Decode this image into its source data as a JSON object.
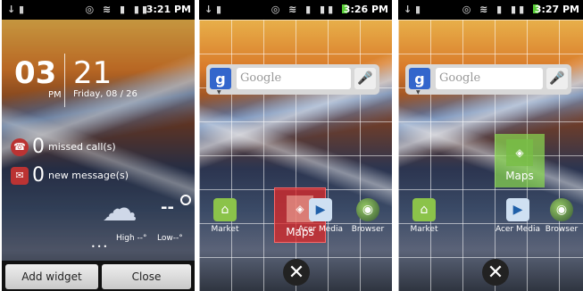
{
  "screens": [
    {
      "status": {
        "time": "3:21 PM"
      },
      "clock": {
        "hour": "03",
        "ampm": "PM",
        "minute": "21",
        "date": "Friday, 08 / 26"
      },
      "notifications": [
        {
          "count": "0",
          "label": "missed call(s)",
          "icon": "missed-call-icon"
        },
        {
          "count": "0",
          "label": "new message(s)",
          "icon": "message-icon"
        }
      ],
      "weather": {
        "temp": "--",
        "high": "High --°",
        "low": "Low--°"
      },
      "page_dots": "•••",
      "buttons": {
        "add_widget": "Add widget",
        "close": "Close"
      }
    },
    {
      "status": {
        "time": "3:26 PM"
      },
      "search": {
        "placeholder": "Google"
      },
      "apps": [
        "Market",
        "Acer Media",
        "Browser"
      ],
      "dragging": "Maps",
      "delete_icon": "✕"
    },
    {
      "status": {
        "time": "3:27 PM"
      },
      "search": {
        "placeholder": "Google"
      },
      "apps": [
        "Market",
        "Acer Media",
        "Browser"
      ],
      "dropped": "Maps",
      "delete_icon": "✕"
    }
  ],
  "colors": {
    "accent_green": "#5c3",
    "google_blue": "#3366cc",
    "drag_red": "#dc2828",
    "drop_green": "#8cdc50"
  }
}
